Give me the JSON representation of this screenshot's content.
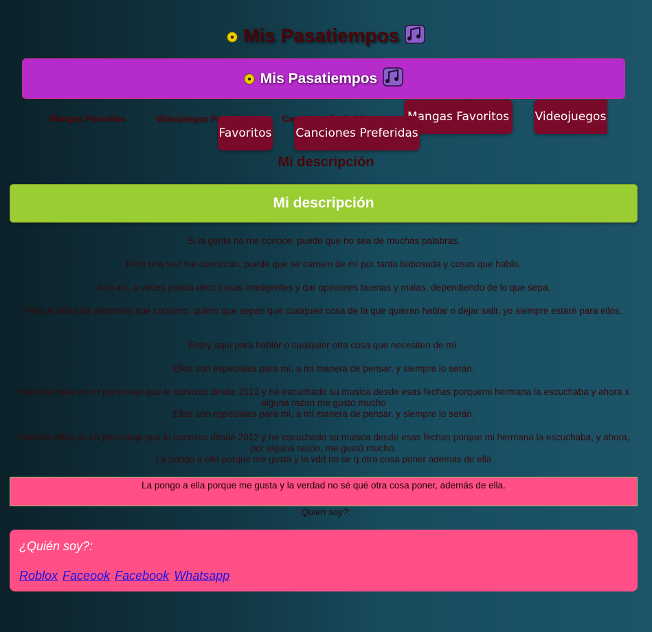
{
  "page": {
    "title": "Mis Pasatiempos",
    "banner_title": "Mis Pasatiempos"
  },
  "nav": {
    "ghost_items": [
      "Mangas Favoritos",
      "Videojuegos Favoritos",
      "Canciones Preferidas"
    ],
    "buttons": [
      "Mangas Favoritos",
      "Videojuegos",
      "Favoritos",
      "Canciones Preferidas"
    ]
  },
  "descripcion": {
    "heading": "Mi descripción",
    "box_heading": "Mi descripción",
    "paragraphs": [
      "Si la gente no me conoce, puede que no sea de muchas palabras.",
      "Pero una vez me conozcan, puede que se cansen de mí por tanta babosada y cosas que hablo.",
      "Aun así, a veces puedo decir cosas inteligentes y dar opiniones buenas y malas, dependiendo de lo que sepa.",
      "Pero a todas las personas que conozco, quiero que sepan que cualquier cosa de la que quieran hablar o dejar salir, yo siempre estaré para ellos.",
      "Estoy aquí para hablar o cualquier otra cosa que necesiten de mí.",
      "Ellos son especiales para mí, a mi manera de pensar, y siempre lo serán.",
      "Hatsune miku es un personaje que lo conozco desde 2012 y he escuchado su musica desde esas fechas porquemi hermana la escuchaba y ahora x alguna razon me gusto mucho",
      "Ellos son especiales para mí, a mi manera de pensar, y siempre lo serán.",
      "Hatsune Miku es un personaje que lo conozco desde 2012 y he escuchado su música desde esas fechas porque mi hermana la escuchaba, y ahora, por alguna razón, me gustó mucho.",
      "La pongo a ella porque me gusta y la vdd no se q otra cosa poner ademas de ella"
    ],
    "highlight": "La pongo a ella porque me gusta y la verdad no sé qué otra cosa poner, además de ella."
  },
  "quien": {
    "plain_label": "Quien soy?:",
    "title": "¿Quién soy?:",
    "links": [
      "Roblox",
      "Faceook",
      "Facebook",
      "Whatsapp"
    ]
  },
  "colors": {
    "banner": "#b52bcc",
    "nav_button": "#7a0a2a",
    "green_box": "#9acd32",
    "pink_box": "#ff4f86",
    "link": "#1a14e6"
  },
  "icons": [
    "disc-icon",
    "music-notes-icon"
  ]
}
